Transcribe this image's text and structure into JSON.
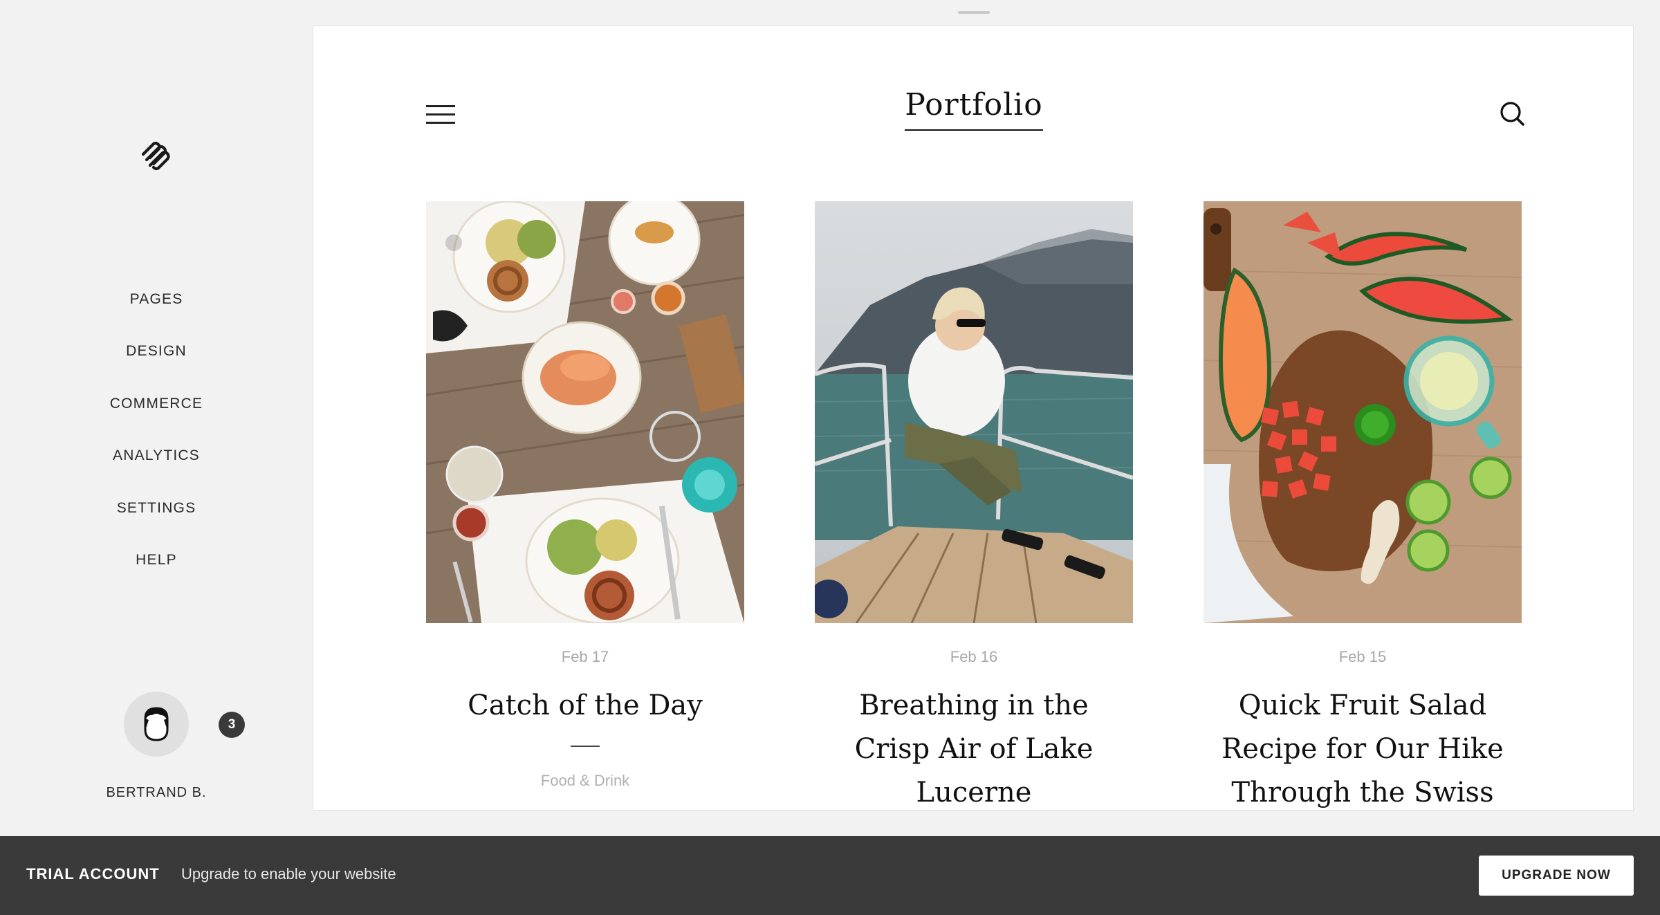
{
  "sidebar": {
    "logo_icon": "squarespace-logo-icon",
    "nav": [
      {
        "label": "PAGES"
      },
      {
        "label": "DESIGN"
      },
      {
        "label": "COMMERCE"
      },
      {
        "label": "ANALYTICS"
      },
      {
        "label": "SETTINGS"
      },
      {
        "label": "HELP"
      }
    ],
    "user": {
      "avatar_icon": "user-avatar-icon",
      "notification_count": "3",
      "name": "BERTRAND B."
    }
  },
  "preview": {
    "site_title": "Portfolio",
    "menu_icon": "hamburger-menu-icon",
    "search_icon": "search-icon",
    "posts": [
      {
        "date": "Feb 17",
        "title": "Catch of the Day",
        "category": "Food & Drink",
        "image": "food-table-photo"
      },
      {
        "date": "Feb 16",
        "title": "Breathing in the Crisp Air of Lake Lucerne",
        "image": "lake-boat-photo"
      },
      {
        "date": "Feb 15",
        "title": "Quick Fruit Salad Recipe for Our Hike Through the Swiss Alps",
        "image": "watermelon-board-photo"
      }
    ]
  },
  "trial_bar": {
    "label": "TRIAL ACCOUNT",
    "message": "Upgrade to enable your website",
    "button": "UPGRADE NOW"
  },
  "colors": {
    "sidebar_bg": "#f2f2f2",
    "trial_bar_bg": "#3a3a3a",
    "badge_bg": "#3a3a3a",
    "date_text": "#a8a8a8"
  }
}
